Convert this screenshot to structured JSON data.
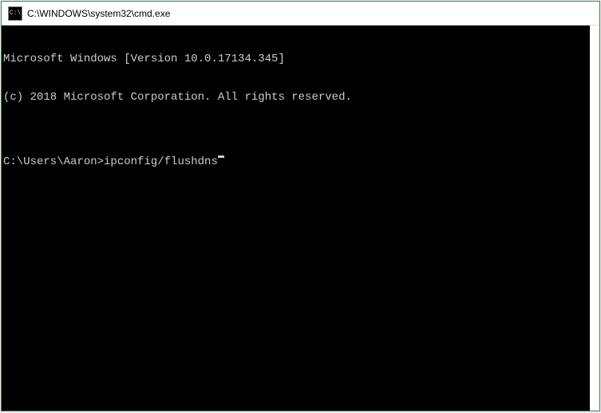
{
  "window": {
    "title": "C:\\WINDOWS\\system32\\cmd.exe",
    "icon_label": "C:\\"
  },
  "terminal": {
    "line1": "Microsoft Windows [Version 10.0.17134.345]",
    "line2": "(c) 2018 Microsoft Corporation. All rights reserved.",
    "blank": "",
    "prompt": "C:\\Users\\Aaron>",
    "command": "ipconfig/flushdns"
  }
}
